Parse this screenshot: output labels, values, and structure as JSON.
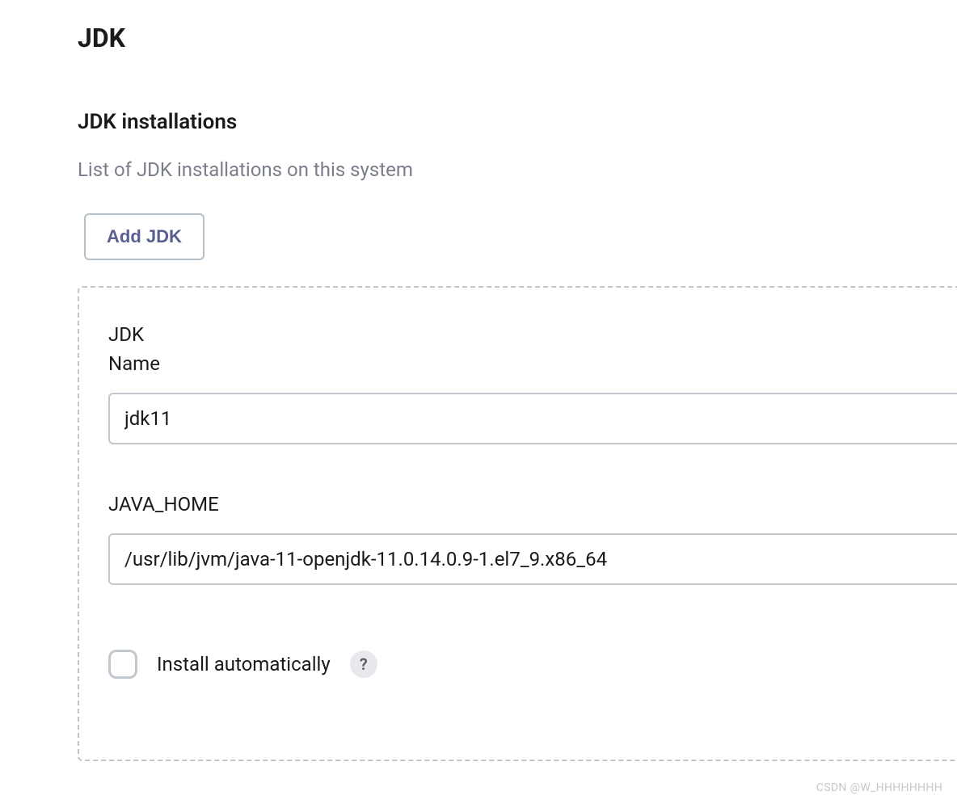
{
  "page": {
    "title": "JDK"
  },
  "section": {
    "title": "JDK installations",
    "description": "List of JDK installations on this system",
    "add_button_label": "Add JDK"
  },
  "jdk_entry": {
    "group_label": "JDK",
    "name_label": "Name",
    "name_value": "jdk11",
    "java_home_label": "JAVA_HOME",
    "java_home_value": "/usr/lib/jvm/java-11-openjdk-11.0.14.0.9-1.el7_9.x86_64",
    "install_auto_label": "Install automatically",
    "install_auto_checked": false,
    "help_symbol": "?"
  },
  "watermark": "CSDN @W_HHHHHHHH"
}
